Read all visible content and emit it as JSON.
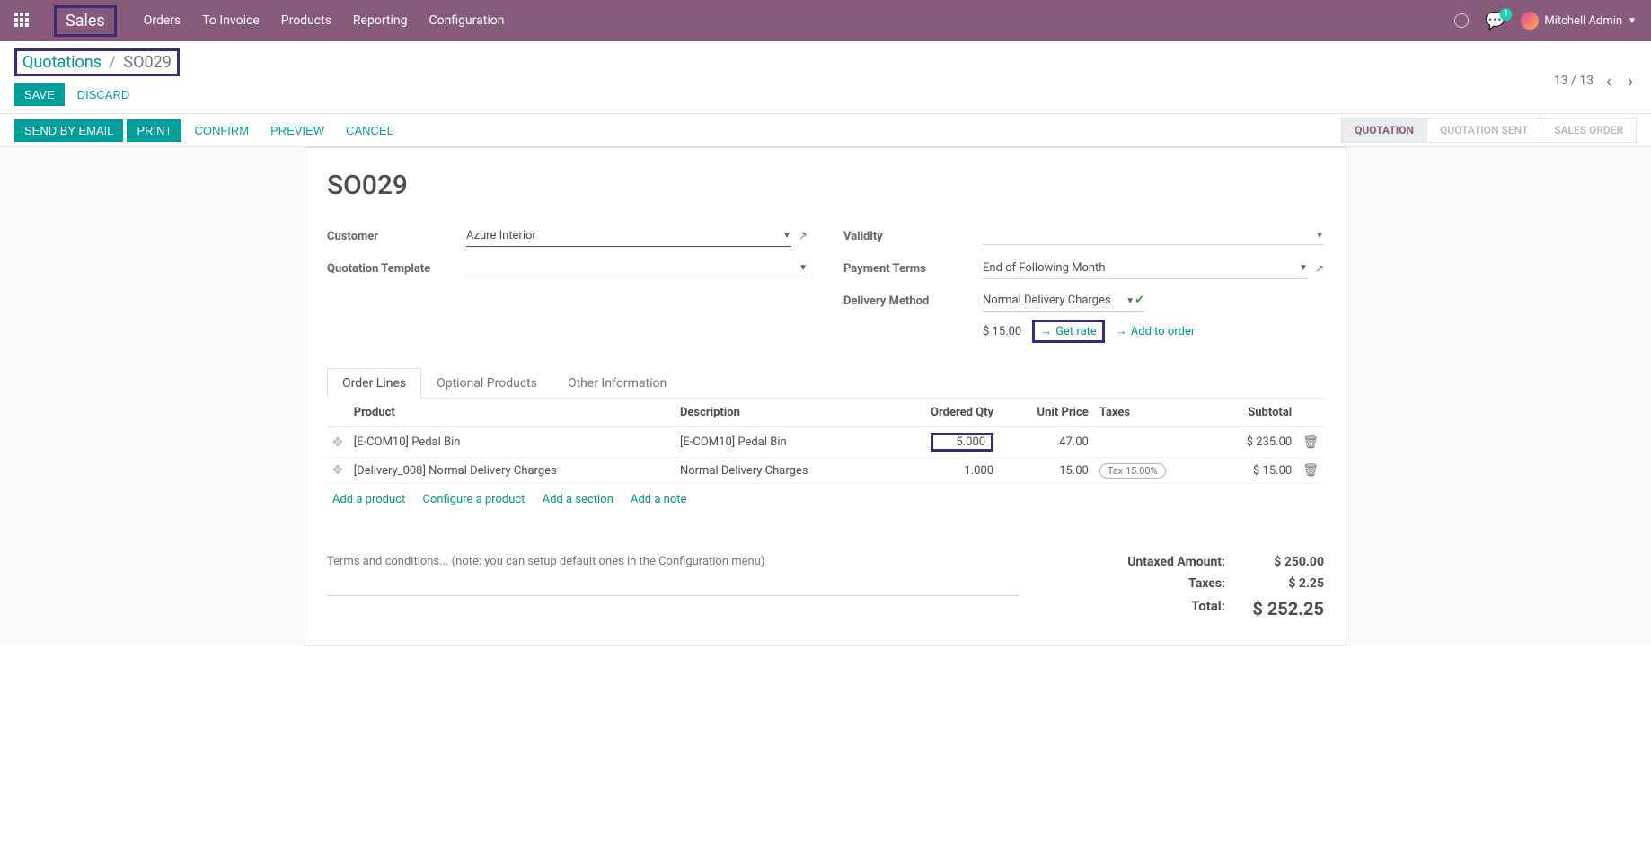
{
  "navbar": {
    "brand": "Sales",
    "menu": [
      "Orders",
      "To Invoice",
      "Products",
      "Reporting",
      "Configuration"
    ],
    "chat_badge": "1",
    "user_name": "Mitchell Admin"
  },
  "breadcrumb": {
    "parent": "Quotations",
    "current": "SO029"
  },
  "buttons": {
    "save": "SAVE",
    "discard": "DISCARD",
    "send_by_email": "SEND BY EMAIL",
    "print": "PRINT",
    "confirm": "CONFIRM",
    "preview": "PREVIEW",
    "cancel": "CANCEL"
  },
  "pager": {
    "text": "13 / 13"
  },
  "status": {
    "steps": [
      "QUOTATION",
      "QUOTATION SENT",
      "SALES ORDER"
    ],
    "active_index": 0
  },
  "form": {
    "title": "SO029",
    "labels": {
      "customer": "Customer",
      "quotation_template": "Quotation Template",
      "validity": "Validity",
      "payment_terms": "Payment Terms",
      "delivery_method": "Delivery Method"
    },
    "values": {
      "customer": "Azure Interior",
      "quotation_template": "",
      "validity": "",
      "payment_terms": "End of Following Month",
      "delivery_method": "Normal Delivery Charges",
      "rate": "$ 15.00"
    },
    "links": {
      "get_rate": "Get rate",
      "add_to_order": "Add to order"
    }
  },
  "tabs": [
    "Order Lines",
    "Optional Products",
    "Other Information"
  ],
  "table": {
    "headers": {
      "product": "Product",
      "description": "Description",
      "qty": "Ordered Qty",
      "unit_price": "Unit Price",
      "taxes": "Taxes",
      "subtotal": "Subtotal"
    },
    "rows": [
      {
        "product": "[E-COM10] Pedal Bin",
        "description": "[E-COM10] Pedal Bin",
        "qty": "5.000",
        "qty_highlight": true,
        "unit_price": "47.00",
        "taxes": "",
        "subtotal": "$ 235.00"
      },
      {
        "product": "[Delivery_008] Normal Delivery Charges",
        "description": "Normal Delivery Charges",
        "qty": "1.000",
        "qty_highlight": false,
        "unit_price": "15.00",
        "taxes": "Tax 15.00%",
        "subtotal": "$ 15.00"
      }
    ],
    "add_links": {
      "add_product": "Add a product",
      "configure_product": "Configure a product",
      "add_section": "Add a section",
      "add_note": "Add a note"
    }
  },
  "terms_placeholder": "Terms and conditions... (note: you can setup default ones in the Configuration menu)",
  "totals": {
    "untaxed_label": "Untaxed Amount:",
    "untaxed_value": "$ 250.00",
    "taxes_label": "Taxes:",
    "taxes_value": "$ 2.25",
    "total_label": "Total:",
    "total_value": "$ 252.25"
  }
}
